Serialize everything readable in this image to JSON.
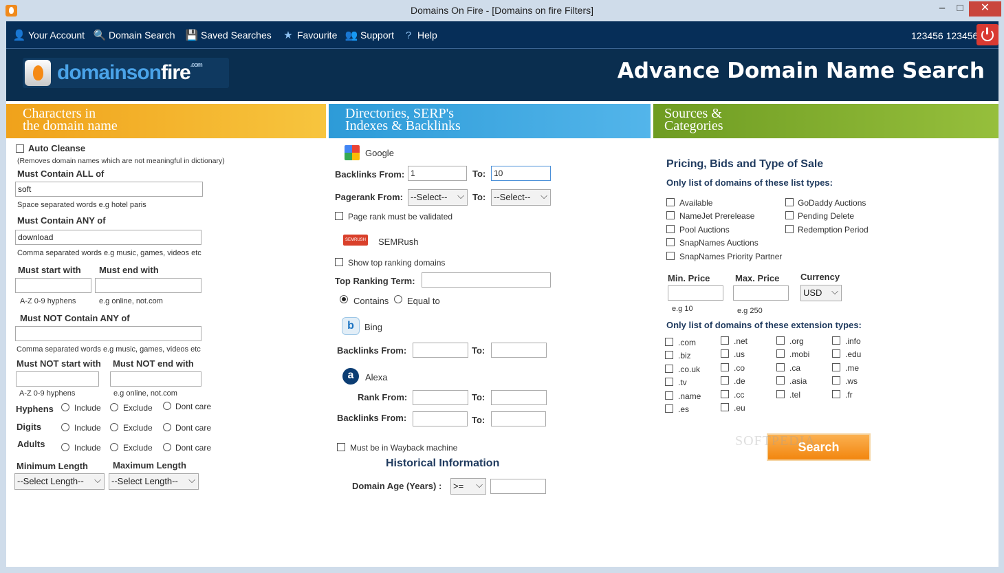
{
  "window": {
    "title": "Domains On Fire - [Domains on fire Filters]",
    "min": "–",
    "max": "□",
    "close": "✕"
  },
  "nav": {
    "items": [
      {
        "label": "Your Account",
        "icon": "user-icon"
      },
      {
        "label": "Domain Search",
        "icon": "magnifier-icon"
      },
      {
        "label": "Saved Searches",
        "icon": "floppy-disk-icon"
      },
      {
        "label": "Favourite",
        "icon": "star-icon"
      },
      {
        "label": "Support",
        "icon": "support-people-icon"
      },
      {
        "label": "Help",
        "icon": "help-question-icon"
      }
    ],
    "user": "123456 123456"
  },
  "banner": {
    "logo_prefix": "domainson",
    "logo_fire": "fire",
    "logo_suffix": ".com",
    "title": "Advance Domain Name Search"
  },
  "sections": {
    "chars_title_1": "Characters in",
    "chars_title_2": "the domain name",
    "dirs_title_1": "Directories, SERP's",
    "dirs_title_2": "Indexes & Backlinks",
    "sources_title_1": "Sources &",
    "sources_title_2": "Categories"
  },
  "chars": {
    "auto_cleanse": "Auto Cleanse",
    "auto_cleanse_hint": "(Removes domain names which are not meaningful in dictionary)",
    "must_all_label": "Must Contain ALL of",
    "must_all_value": "soft",
    "must_all_hint": "Space separated words e.g hotel paris",
    "must_any_label": "Must Contain ANY of",
    "must_any_value": "download",
    "must_any_hint": "Comma separated words e.g music, games, videos etc",
    "start_label": "Must start with",
    "end_label": "Must end with",
    "start_hint": "A-Z 0-9 hyphens",
    "end_hint": "e.g online, not.com",
    "not_any_label": "Must NOT Contain ANY of",
    "not_any_hint": "Comma separated words e.g music, games, videos etc",
    "not_start_label": "Must NOT start with",
    "not_end_label": "Must NOT end with",
    "not_start_hint": "A-Z 0-9 hyphens",
    "not_end_hint": "e.g online, not.com",
    "hyphens": "Hyphens",
    "digits": "Digits",
    "adults": "Adults",
    "include": "Include",
    "exclude": "Exclude",
    "dont_care": "Dont care",
    "min_len_label": "Minimum Length",
    "max_len_label": "Maximum Length",
    "min_len_value": "--Select Length--",
    "max_len_value": "--Select Length--"
  },
  "dirs": {
    "google": "Google",
    "backlinks_from": "Backlinks From:",
    "to": "To:",
    "google_from": "1",
    "google_to": "10",
    "pagerank_from": "Pagerank From:",
    "pr_from_value": "--Select--",
    "pr_to_value": "--Select--",
    "pr_validated": "Page rank must be validated",
    "semrush": "SEMRush",
    "semrush_logo_text": "SEMRUSH",
    "show_top": "Show top ranking domains",
    "top_term": "Top Ranking Term:",
    "contains": "Contains",
    "equal_to": "Equal to",
    "bing": "Bing",
    "bing_logo": "b",
    "alexa": "Alexa",
    "alexa_logo": "a",
    "rank_from": "Rank From:",
    "wayback": "Must be in Wayback machine",
    "historical": "Historical Information",
    "domain_age": "Domain Age (Years) :",
    "age_op": ">="
  },
  "sources": {
    "pricing_title": "Pricing, Bids and Type of Sale",
    "list_types_label": "Only list of domains of these list types:",
    "list_types_left": [
      "Available",
      "NameJet Prerelease",
      "Pool Auctions",
      "SnapNames Auctions",
      "SnapNames Priority Partner"
    ],
    "list_types_right": [
      "GoDaddy Auctions",
      "Pending Delete",
      "Redemption Period"
    ],
    "min_price": "Min. Price",
    "max_price": "Max. Price",
    "currency": "Currency",
    "currency_value": "USD",
    "min_hint": "e.g  10",
    "max_hint": "e.g  250",
    "ext_label": "Only list of domains of these extension types:",
    "ext_col1": [
      ".com",
      ".biz",
      ".co.uk",
      ".tv",
      ".name",
      ".es"
    ],
    "ext_col2": [
      ".net",
      ".us",
      ".co",
      ".de",
      ".cc",
      ".eu"
    ],
    "ext_col3": [
      ".org",
      ".mobi",
      ".ca",
      ".asia",
      ".tel"
    ],
    "ext_col4": [
      ".info",
      ".edu",
      ".me",
      ".ws",
      ".fr"
    ],
    "search": "Search",
    "watermark": "SOFTPEDIA"
  }
}
